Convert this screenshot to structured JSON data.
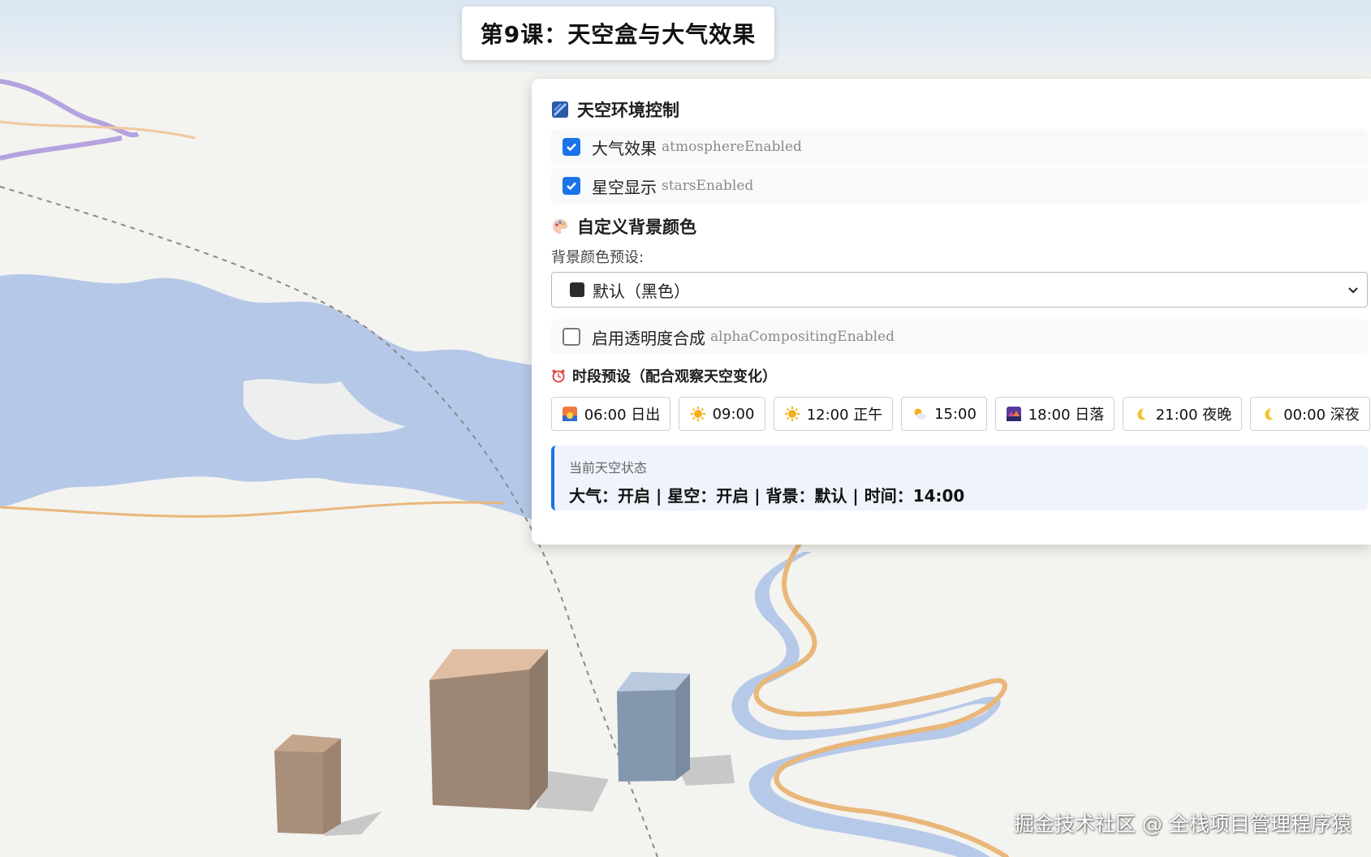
{
  "page": {
    "title": "第9课：天空盒与大气效果",
    "watermark": "掘金技术社区 @ 全栈项目管理程序猿"
  },
  "sky_panel": {
    "heading": "天空环境控制",
    "heading_icon": "sky-image-icon",
    "atmosphere": {
      "label": "大气效果",
      "prop": "atmosphereEnabled",
      "checked": true
    },
    "stars": {
      "label": "星空显示",
      "prop": "starsEnabled",
      "checked": true
    }
  },
  "background_panel": {
    "heading": "自定义背景颜色",
    "heading_icon": "palette-icon",
    "preset_label": "背景颜色预设:",
    "preset_selected": "默认（黑色）",
    "swatch_color": "#2b2b2b",
    "alpha": {
      "label": "启用透明度合成",
      "prop": "alphaCompositingEnabled",
      "checked": false
    }
  },
  "time_panel": {
    "heading": "时段预设（配合观察天空变化）",
    "heading_icon": "alarm-clock-icon",
    "presets": [
      {
        "label": "06:00 日出",
        "icon": "sunrise-icon"
      },
      {
        "label": "09:00",
        "icon": "sun-icon"
      },
      {
        "label": "12:00 正午",
        "icon": "sun-icon"
      },
      {
        "label": "15:00",
        "icon": "sun-cloud-icon"
      },
      {
        "label": "18:00 日落",
        "icon": "sunset-icon"
      },
      {
        "label": "21:00 夜晚",
        "icon": "moon-icon"
      },
      {
        "label": "00:00 深夜",
        "icon": "moon-icon"
      }
    ]
  },
  "status": {
    "label": "当前天空状态",
    "value": "大气：开启 | 星空：开启 | 背景：默认 | 时间：14:00"
  },
  "colors": {
    "accent": "#1a73e8",
    "water": "#b7c9e8",
    "river_road": "#e9b77a",
    "building_tan": "#a88f79",
    "building_blue": "#8497ad"
  }
}
